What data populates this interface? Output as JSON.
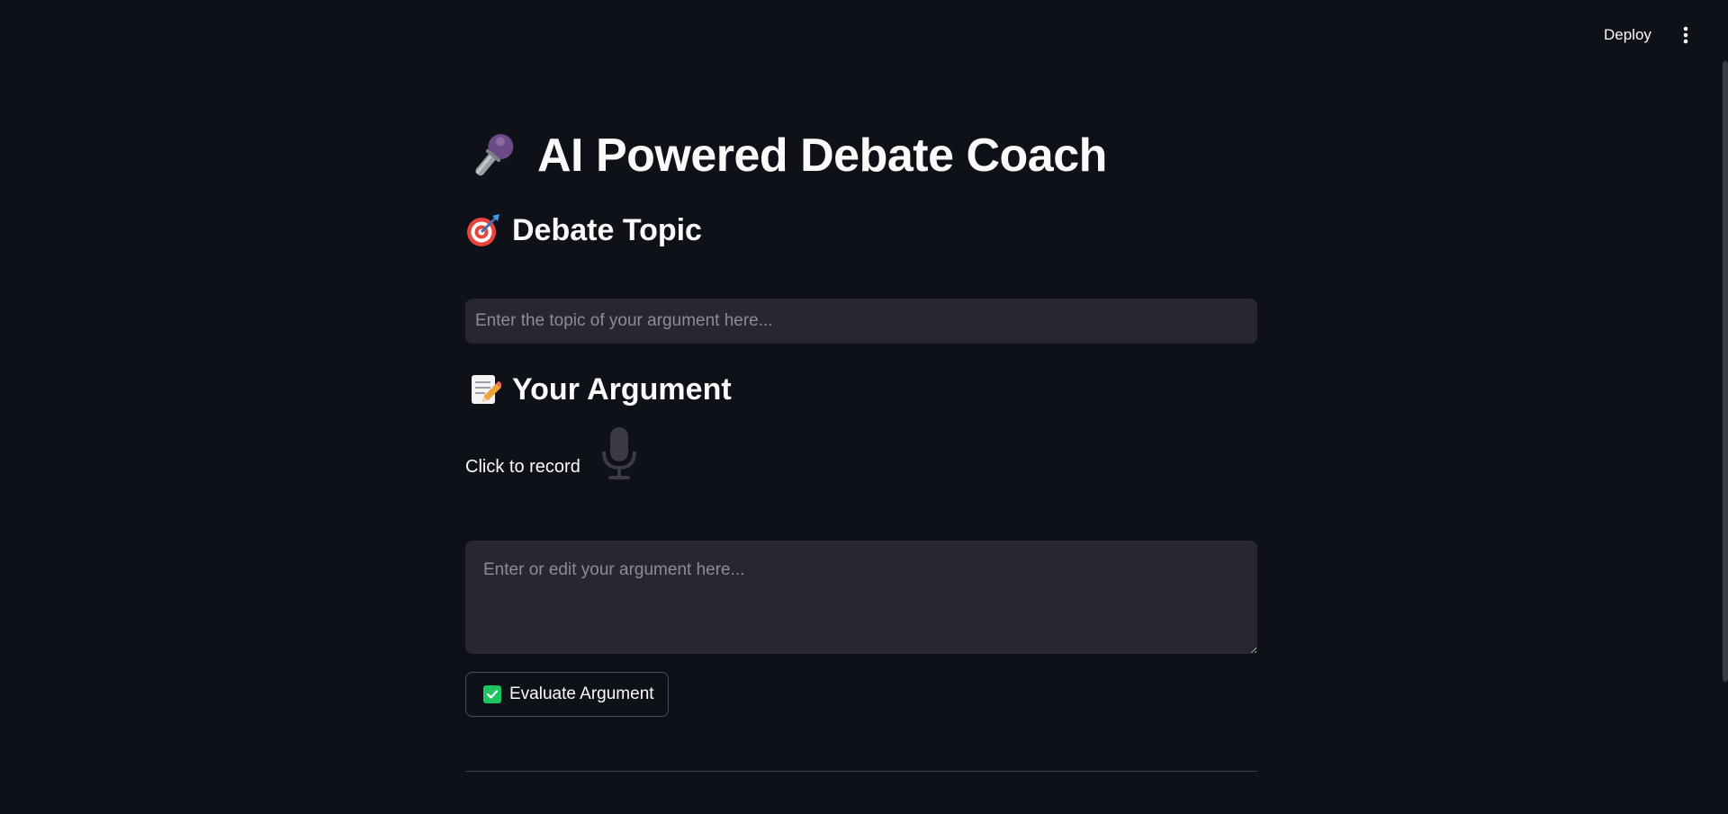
{
  "header": {
    "deploy_label": "Deploy",
    "menu_icon": "vertical-ellipsis-icon"
  },
  "page": {
    "title": "AI Powered Debate Coach",
    "title_icon": "microphone-icon"
  },
  "topic_section": {
    "heading": "Debate Topic",
    "heading_icon": "target-icon",
    "input_value": "",
    "input_placeholder": "Enter the topic of your argument here..."
  },
  "argument_section": {
    "heading": "Your Argument",
    "heading_icon": "memo-icon",
    "record_label": "Click to record",
    "record_icon": "microphone-icon",
    "textarea_value": "",
    "textarea_placeholder": "Enter or edit your argument here..."
  },
  "actions": {
    "evaluate_label": "Evaluate Argument",
    "evaluate_icon": "check-mark-icon"
  },
  "colors": {
    "background": "#0e1117",
    "input_background": "#262730",
    "accent_green": "#1ec45f",
    "text": "#fafafa",
    "placeholder": "#8b8d96"
  }
}
